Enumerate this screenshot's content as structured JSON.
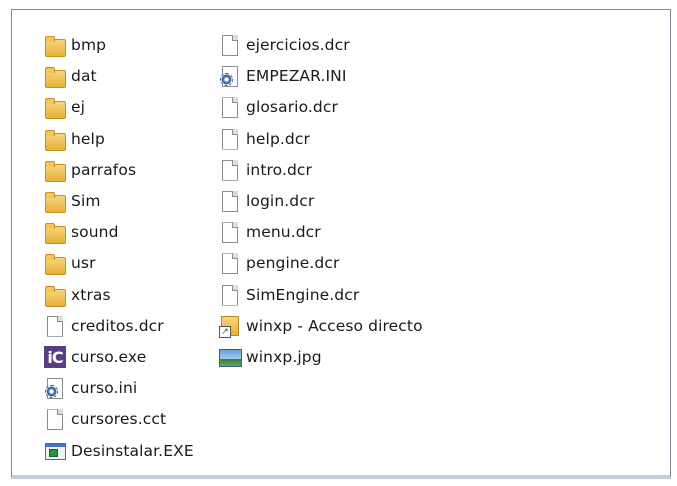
{
  "columns": [
    {
      "items": [
        {
          "name": "bmp",
          "icon": "folder-icon",
          "type": "folder"
        },
        {
          "name": "dat",
          "icon": "folder-icon",
          "type": "folder"
        },
        {
          "name": "ej",
          "icon": "folder-icon",
          "type": "folder"
        },
        {
          "name": "help",
          "icon": "folder-icon",
          "type": "folder"
        },
        {
          "name": "parrafos",
          "icon": "folder-icon",
          "type": "folder"
        },
        {
          "name": "Sim",
          "icon": "folder-icon",
          "type": "folder"
        },
        {
          "name": "sound",
          "icon": "folder-icon",
          "type": "folder"
        },
        {
          "name": "usr",
          "icon": "folder-icon",
          "type": "folder"
        },
        {
          "name": "xtras",
          "icon": "folder-icon",
          "type": "folder"
        },
        {
          "name": "creditos.dcr",
          "icon": "file-icon",
          "type": "file"
        },
        {
          "name": "curso.exe",
          "icon": "application-icon",
          "type": "ic"
        },
        {
          "name": "curso.ini",
          "icon": "settings-file-icon",
          "type": "ini"
        },
        {
          "name": "cursores.cct",
          "icon": "file-icon",
          "type": "file"
        },
        {
          "name": "Desinstalar.EXE",
          "icon": "installer-icon",
          "type": "exe"
        }
      ]
    },
    {
      "items": [
        {
          "name": "ejercicios.dcr",
          "icon": "file-icon",
          "type": "file"
        },
        {
          "name": "EMPEZAR.INI",
          "icon": "settings-file-icon",
          "type": "ini"
        },
        {
          "name": "glosario.dcr",
          "icon": "file-icon",
          "type": "file"
        },
        {
          "name": "help.dcr",
          "icon": "file-icon",
          "type": "file"
        },
        {
          "name": "intro.dcr",
          "icon": "file-icon",
          "type": "file"
        },
        {
          "name": "login.dcr",
          "icon": "file-icon",
          "type": "file"
        },
        {
          "name": "menu.dcr",
          "icon": "file-icon",
          "type": "file"
        },
        {
          "name": "pengine.dcr",
          "icon": "file-icon",
          "type": "file"
        },
        {
          "name": "SimEngine.dcr",
          "icon": "file-icon",
          "type": "file"
        },
        {
          "name": "winxp - Acceso directo",
          "icon": "shortcut-icon",
          "type": "shortcut"
        },
        {
          "name": "winxp.jpg",
          "icon": "image-file-icon",
          "type": "image"
        }
      ]
    }
  ]
}
